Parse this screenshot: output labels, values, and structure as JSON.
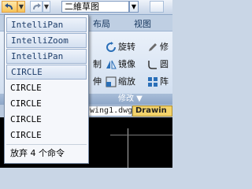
{
  "quick_access": {
    "workspace_name": "二維草图",
    "dropdown_arrow": "▼"
  },
  "ribbon": {
    "tabs": [
      "布局",
      "视图"
    ],
    "tools": {
      "rotate": "旋转",
      "modify_partial": "修",
      "control_partial": "制",
      "mirror": "镜像",
      "round_partial": "圆",
      "stretch_partial": "伸",
      "scale": "缩放",
      "array_partial": "阵"
    },
    "panel_title": "修改 ▼"
  },
  "doc_tabs": {
    "tab1": "wing1.dwg",
    "tab2": "Drawin"
  },
  "undo_menu": {
    "items": [
      "IntelliPan",
      "IntelliZoom",
      "IntelliPan",
      "CIRCLE",
      "CIRCLE",
      "CIRCLE",
      "CIRCLE",
      "CIRCLE"
    ],
    "status": "放弃 4 个命令"
  }
}
